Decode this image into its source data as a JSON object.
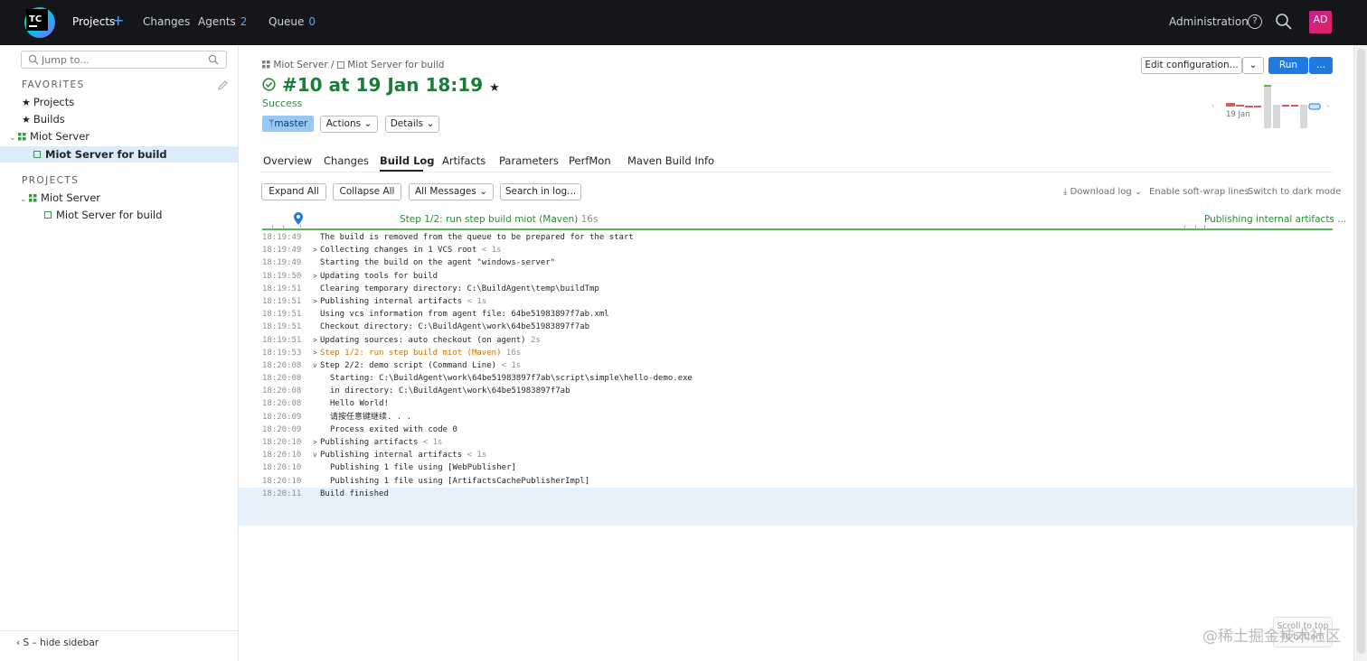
{
  "topbar": {
    "logo_text": "TC",
    "nav": {
      "projects": "Projects",
      "changes": "Changes",
      "agents": "Agents",
      "agents_count": "2",
      "queue": "Queue",
      "queue_count": "0"
    },
    "administration": "Administration",
    "help_glyph": "?",
    "avatar": "AD"
  },
  "sidebar": {
    "jump_placeholder": "Jump to...",
    "favorites_title": "FAVORITES",
    "favorites": [
      {
        "label": "Projects",
        "icon": "star-icon"
      },
      {
        "label": "Builds",
        "icon": "star-icon"
      },
      {
        "label": "Miot Server",
        "icon": "project-icon"
      },
      {
        "label": "Miot Server for build",
        "icon": "build-config-icon"
      }
    ],
    "projects_title": "PROJECTS",
    "projects": [
      {
        "label": "Miot Server",
        "icon": "project-icon"
      },
      {
        "label": "Miot Server for build",
        "icon": "build-config-icon"
      }
    ],
    "hide_sidebar": "S – hide sidebar"
  },
  "header": {
    "breadcrumb_project": "Miot Server",
    "breadcrumb_sep": "/",
    "breadcrumb_config": "Miot Server for build",
    "build_title": "#10 at 19 Jan 18:19",
    "status": "Success",
    "branch": "master",
    "actions": "Actions",
    "details": "Details",
    "edit_configuration": "Edit configuration...",
    "run": "Run",
    "more": "...",
    "spark_date": "19 Jan"
  },
  "tabs": [
    "Overview",
    "Changes",
    "Build Log",
    "Artifacts",
    "Parameters",
    "PerfMon",
    "Maven Build Info"
  ],
  "toolbar": {
    "expand_all": "Expand All",
    "collapse_all": "Collapse All",
    "all_messages": "All Messages",
    "search_in_log": "Search in log...",
    "download_log": "Download log",
    "soft_wrap": "Enable soft-wrap lines",
    "dark_mode": "Switch to dark mode"
  },
  "timeline": {
    "step_label": "Step 1/2: run step build miot (Maven)",
    "step_duration": "16s",
    "end_label": "Publishing internal artifacts ..."
  },
  "log": [
    {
      "ts": "18:19:49",
      "toggle": "",
      "indent": 0,
      "msg": "The build is removed from the queue to be prepared for the start",
      "dur": ""
    },
    {
      "ts": "18:19:49",
      "toggle": ">",
      "indent": 0,
      "msg": "Collecting changes in 1 VCS root",
      "dur": "< 1s"
    },
    {
      "ts": "18:19:49",
      "toggle": "",
      "indent": 0,
      "msg": "Starting the build on the agent \"windows-server\"",
      "dur": ""
    },
    {
      "ts": "18:19:50",
      "toggle": ">",
      "indent": 0,
      "msg": "Updating tools for build",
      "dur": ""
    },
    {
      "ts": "18:19:51",
      "toggle": "",
      "indent": 0,
      "msg": "Clearing temporary directory: C:\\BuildAgent\\temp\\buildTmp",
      "dur": ""
    },
    {
      "ts": "18:19:51",
      "toggle": ">",
      "indent": 0,
      "msg": "Publishing internal artifacts",
      "dur": "< 1s"
    },
    {
      "ts": "18:19:51",
      "toggle": "",
      "indent": 0,
      "msg": "Using vcs information from agent file: 64be51983897f7ab.xml",
      "dur": ""
    },
    {
      "ts": "18:19:51",
      "toggle": "",
      "indent": 0,
      "msg": "Checkout directory: C:\\BuildAgent\\work\\64be51983897f7ab",
      "dur": ""
    },
    {
      "ts": "18:19:51",
      "toggle": ">",
      "indent": 0,
      "msg": "Updating sources: auto checkout (on agent)",
      "dur": "2s"
    },
    {
      "ts": "18:19:53",
      "toggle": ">",
      "indent": 0,
      "msg": "Step 1/2: run step build miot (Maven)",
      "dur": "16s",
      "warn": true
    },
    {
      "ts": "18:20:08",
      "toggle": "v",
      "indent": 0,
      "msg": "Step 2/2: demo script (Command Line)",
      "dur": "< 1s"
    },
    {
      "ts": "18:20:08",
      "toggle": "",
      "indent": 1,
      "msg": "Starting: C:\\BuildAgent\\work\\64be51983897f7ab\\script\\simple\\hello-demo.exe",
      "dur": ""
    },
    {
      "ts": "18:20:08",
      "toggle": "",
      "indent": 1,
      "msg": "in directory: C:\\BuildAgent\\work\\64be51983897f7ab",
      "dur": ""
    },
    {
      "ts": "18:20:08",
      "toggle": "",
      "indent": 1,
      "msg": "Hello World!",
      "dur": ""
    },
    {
      "ts": "18:20:09",
      "toggle": "",
      "indent": 1,
      "msg": "请按任意键继续. . .",
      "dur": ""
    },
    {
      "ts": "18:20:09",
      "toggle": "",
      "indent": 1,
      "msg": "Process exited with code 0",
      "dur": ""
    },
    {
      "ts": "18:20:10",
      "toggle": ">",
      "indent": 0,
      "msg": "Publishing artifacts",
      "dur": "< 1s"
    },
    {
      "ts": "18:20:10",
      "toggle": "v",
      "indent": 0,
      "msg": "Publishing internal artifacts",
      "dur": "< 1s"
    },
    {
      "ts": "18:20:10",
      "toggle": "",
      "indent": 1,
      "msg": "Publishing 1 file using [WebPublisher]",
      "dur": ""
    },
    {
      "ts": "18:20:10",
      "toggle": "",
      "indent": 1,
      "msg": "Publishing 1 file using [ArtifactsCachePublisherImpl]",
      "dur": ""
    },
    {
      "ts": "18:20:11",
      "toggle": "",
      "indent": 0,
      "msg": "Build finished",
      "dur": "",
      "last": true
    }
  ],
  "scroll_to_top": "Scroll to top",
  "to_bottom": "To bottom",
  "watermark": "@稀土掘金技术社区",
  "colors": {
    "success": "#1b7d3a",
    "accent": "#1f7ae0",
    "branch_bg": "#9ac8f5",
    "warn": "#c87600"
  }
}
